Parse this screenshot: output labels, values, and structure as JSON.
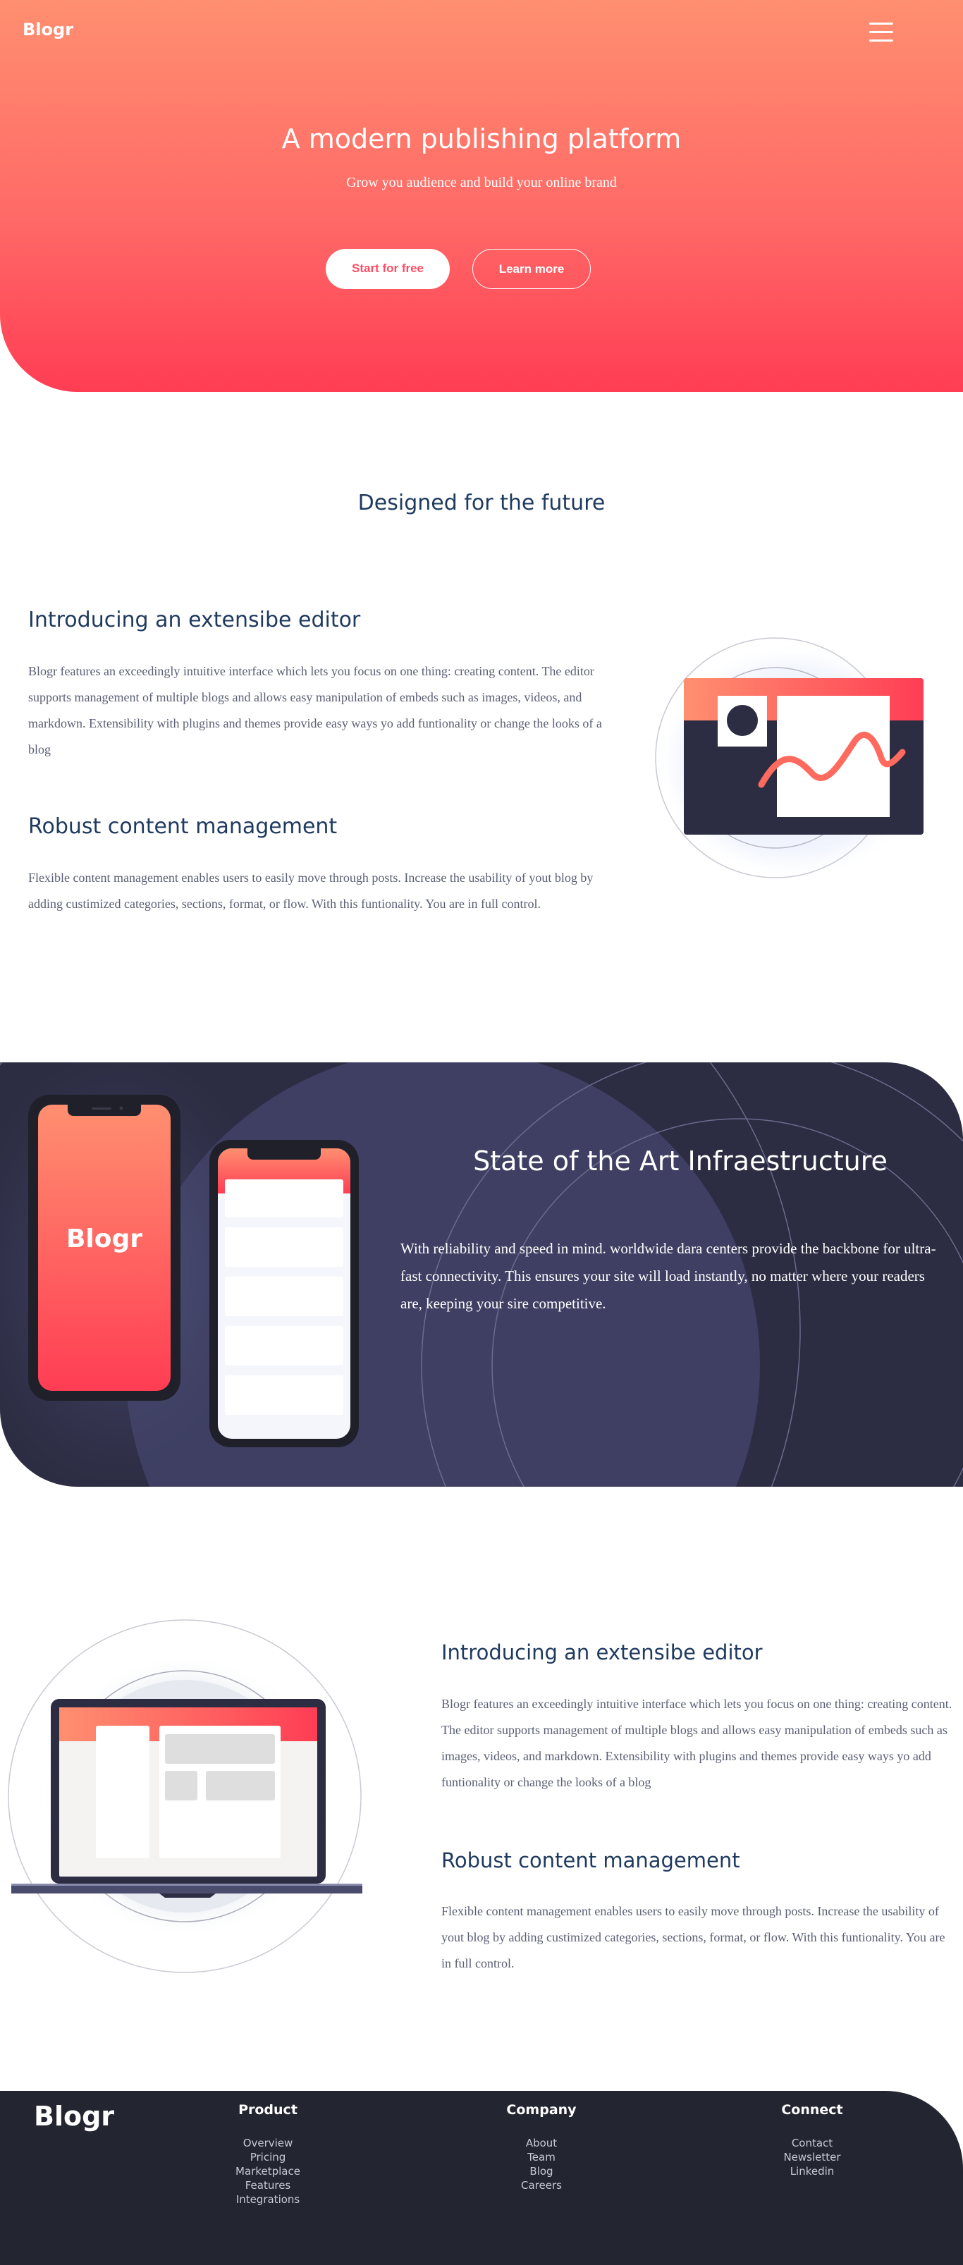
{
  "header": {
    "logo": "Blogr",
    "menu_icon": "hamburger-menu-icon"
  },
  "hero": {
    "title": "A modern publishing platform",
    "subtitle": "Grow you audience and build your online brand",
    "primary_button": "Start for free",
    "secondary_button": "Learn more"
  },
  "designed": {
    "title": "Designed for the future",
    "features": [
      {
        "title": "Introducing an extensibe editor",
        "text": "Blogr features an exceedingly intuitive interface which lets you focus on one thing: creating content. The editor supports management of multiple blogs and allows easy manipulation of embeds such as images, videos, and markdown. Extensibility with plugins and themes provide easy ways yo add funtionality or change the looks of a blog"
      },
      {
        "title": "Robust content management",
        "text": "Flexible content management enables users to easily move through posts. Increase the usability of yout blog by adding custimized categories, sections, format, or flow. With this funtionality. You are in full control."
      }
    ]
  },
  "infrastructure": {
    "phone_logo": "Blogr",
    "title": "State of the Art Infraestructure",
    "text": "With reliability and speed in mind. worldwide dara centers provide the backbone for ultra-fast connectivity. This ensures your site will load instantly, no matter where your readers are, keeping your sire competitive."
  },
  "features2": [
    {
      "title": "Introducing an extensibe editor",
      "text": "Blogr features an exceedingly intuitive interface which lets you focus on one thing: creating content. The editor supports management of multiple blogs and allows easy manipulation of embeds such as images, videos, and markdown. Extensibility with plugins and themes provide easy ways yo add funtionality or change the looks of a blog"
    },
    {
      "title": "Robust content management",
      "text": "Flexible content management enables users to easily move through posts. Increase the usability of yout blog by adding custimized categories, sections, format, or flow. With this funtionality. You are in full control."
    }
  ],
  "footer": {
    "logo": "Blogr",
    "columns": [
      {
        "title": "Product",
        "links": [
          "Overview",
          "Pricing",
          "Marketplace",
          "Features",
          "Integrations"
        ]
      },
      {
        "title": "Company",
        "links": [
          "About",
          "Team",
          "Blog",
          "Careers"
        ]
      },
      {
        "title": "Connect",
        "links": [
          "Contact",
          "Newsletter",
          "Linkedin"
        ]
      }
    ]
  },
  "colors": {
    "accent": "#ff4d63",
    "heading": "#1f3a5f",
    "dark": "#2c2c42",
    "footer": "#232530"
  }
}
